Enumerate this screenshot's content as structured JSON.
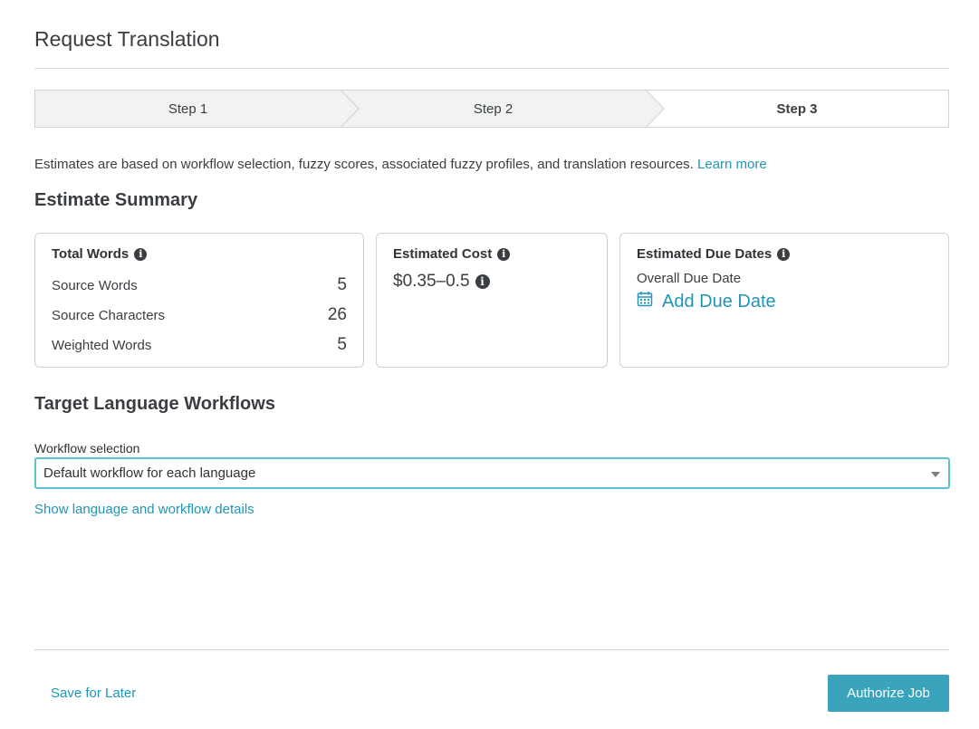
{
  "page": {
    "title": "Request Translation"
  },
  "stepper": {
    "steps": [
      {
        "label": "Step 1"
      },
      {
        "label": "Step 2"
      },
      {
        "label": "Step 3"
      }
    ],
    "active_step": 3
  },
  "info": {
    "text": "Estimates are based on workflow selection, fuzzy scores, associated fuzzy profiles, and translation resources.",
    "link": "Learn more"
  },
  "estimate_summary": {
    "title": "Estimate Summary",
    "total_words": {
      "title": "Total Words",
      "rows": [
        {
          "label": "Source Words",
          "value": "5"
        },
        {
          "label": "Source Characters",
          "value": "26"
        },
        {
          "label": "Weighted Words",
          "value": "5"
        }
      ]
    },
    "estimated_cost": {
      "title": "Estimated Cost",
      "value": "$0.35–0.5"
    },
    "due_dates": {
      "title": "Estimated Due Dates",
      "overall_label": "Overall Due Date",
      "add_label": "Add Due Date"
    }
  },
  "workflows": {
    "title": "Target Language Workflows",
    "field_label": "Workflow selection",
    "selected": "Default workflow for each language",
    "details_link": "Show language and workflow details"
  },
  "footer": {
    "save_label": "Save for Later",
    "authorize_label": "Authorize Job"
  },
  "colors": {
    "accent": "#1f97b4",
    "button": "#3aa4bd",
    "focus_border": "#5cc1d3"
  }
}
